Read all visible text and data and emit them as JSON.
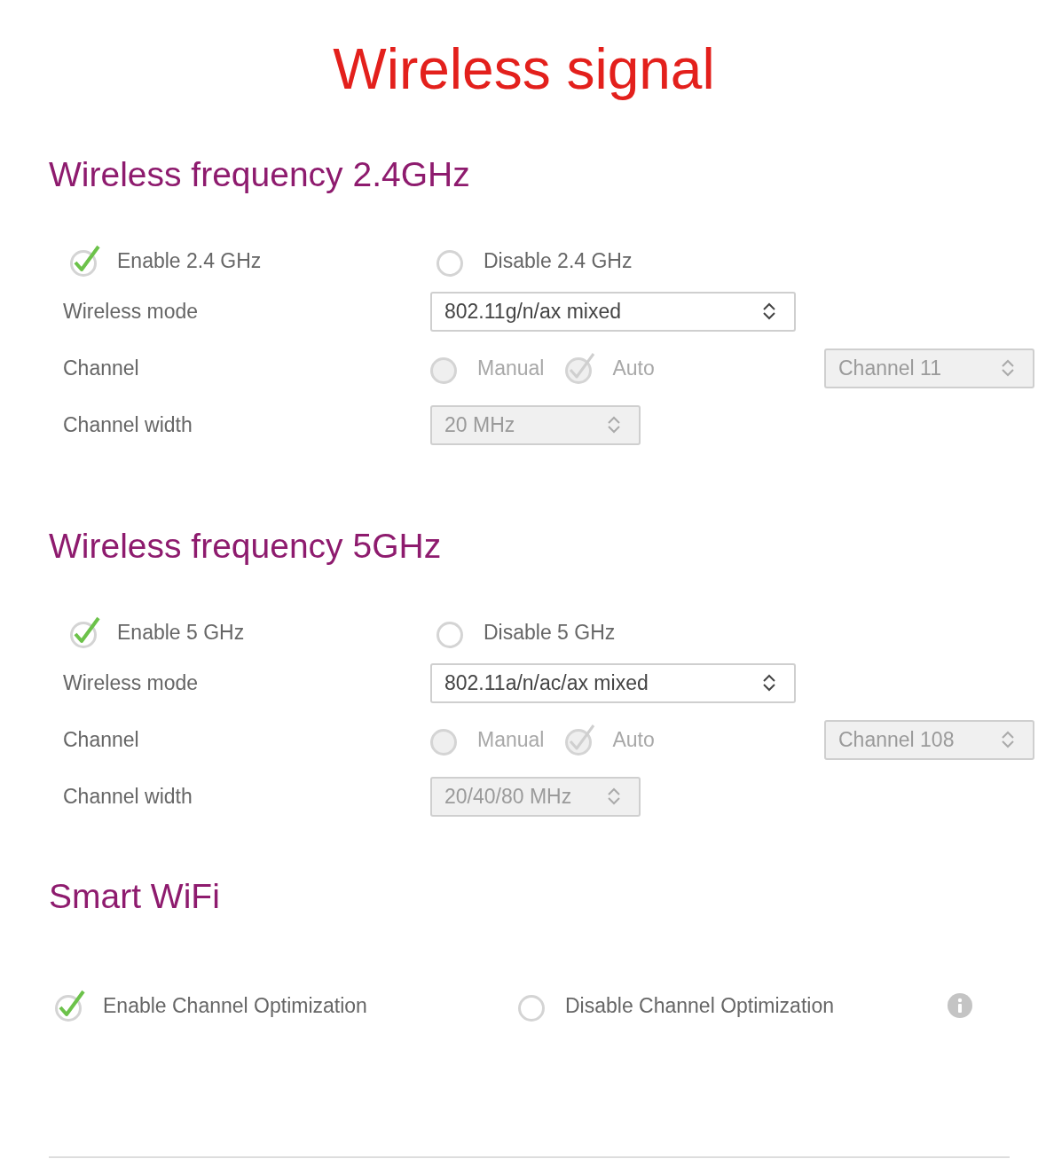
{
  "title": "Wireless signal",
  "sections": [
    {
      "kind": "band",
      "heading": "Wireless frequency 2.4GHz",
      "toggle": [
        {
          "label": "Enable 2.4 GHz",
          "selected": true
        },
        {
          "label": "Disable 2.4 GHz",
          "selected": false
        }
      ],
      "rows": [
        {
          "kind": "select",
          "label": "Wireless mode",
          "value": "802.11g/n/ax mixed",
          "disabled": false
        },
        {
          "kind": "channel",
          "label": "Channel",
          "disabled": true,
          "options": [
            {
              "label": "Manual",
              "selected": false
            },
            {
              "label": "Auto",
              "selected": true
            }
          ],
          "value": "Channel 11"
        },
        {
          "kind": "select",
          "label": "Channel width",
          "value": "20 MHz",
          "disabled": true
        }
      ]
    },
    {
      "kind": "band",
      "heading": "Wireless frequency 5GHz",
      "toggle": [
        {
          "label": "Enable 5 GHz",
          "selected": true
        },
        {
          "label": "Disable 5 GHz",
          "selected": false
        }
      ],
      "rows": [
        {
          "kind": "select",
          "label": "Wireless mode",
          "value": "802.11a/n/ac/ax mixed",
          "disabled": false
        },
        {
          "kind": "channel",
          "label": "Channel",
          "disabled": true,
          "options": [
            {
              "label": "Manual",
              "selected": false
            },
            {
              "label": "Auto",
              "selected": true
            }
          ],
          "value": "Channel 108"
        },
        {
          "kind": "select",
          "label": "Channel width",
          "value": "20/40/80 MHz",
          "disabled": true
        }
      ]
    },
    {
      "kind": "smart",
      "heading": "Smart WiFi",
      "info": true,
      "toggle": [
        {
          "label": "Enable Channel Optimization",
          "selected": true
        },
        {
          "label": "Disable Channel Optimization",
          "selected": false
        }
      ]
    }
  ]
}
